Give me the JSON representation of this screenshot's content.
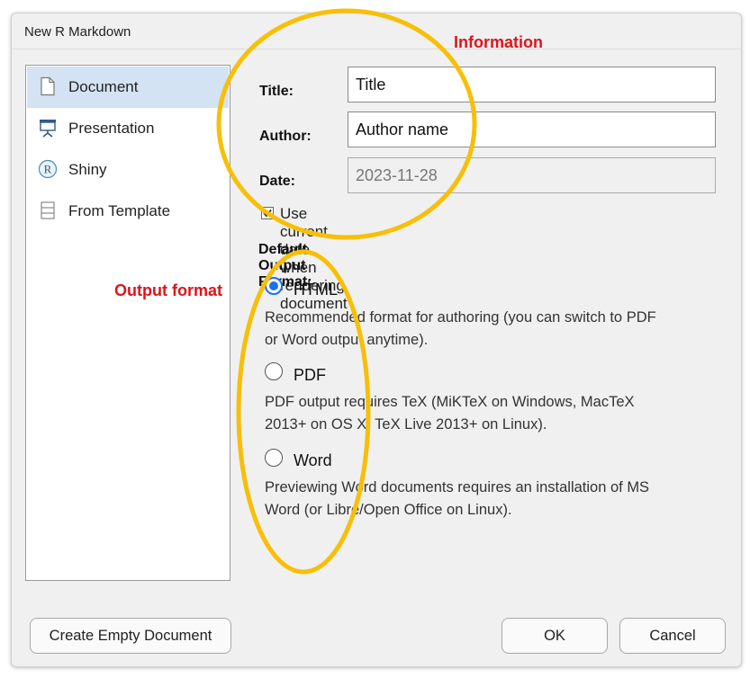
{
  "dialog": {
    "title": "New R Markdown"
  },
  "sidebar": {
    "items": [
      {
        "label": "Document",
        "icon": "document-icon",
        "selected": true
      },
      {
        "label": "Presentation",
        "icon": "presentation-icon",
        "selected": false
      },
      {
        "label": "Shiny",
        "icon": "shiny-r-icon",
        "selected": false
      },
      {
        "label": "From Template",
        "icon": "template-icon",
        "selected": false
      }
    ]
  },
  "form": {
    "title_label": "Title:",
    "title_value": "Title",
    "author_label": "Author:",
    "author_value": "Author name",
    "date_label": "Date:",
    "date_value": "2023-11-28",
    "use_current_date_label": "Use current date when rendering document",
    "use_current_date_checked": true
  },
  "output": {
    "heading": "Default Output Format:",
    "options": [
      {
        "label": "HTML",
        "checked": true,
        "desc1": "Recommended format for authoring (you can switch to PDF",
        "desc2": "or Word output anytime)."
      },
      {
        "label": "PDF",
        "checked": false,
        "desc1": "PDF output requires TeX (MiKTeX on Windows, MacTeX",
        "desc2": "2013+ on OS X, TeX Live 2013+ on Linux)."
      },
      {
        "label": "Word",
        "checked": false,
        "desc1": "Previewing Word documents requires an installation of MS",
        "desc2": "Word (or Libre/Open Office on Linux)."
      }
    ]
  },
  "buttons": {
    "create_empty": "Create Empty Document",
    "ok": "OK",
    "cancel": "Cancel"
  },
  "annotations": {
    "information": "Information",
    "output_format": "Output format",
    "color_text": "#e0131a",
    "color_ellipse": "#f7bf08"
  },
  "colors": {
    "accent": "#1a73e8",
    "selected_bg": "#d3e3f3",
    "dialog_bg": "#f0f0f0"
  }
}
